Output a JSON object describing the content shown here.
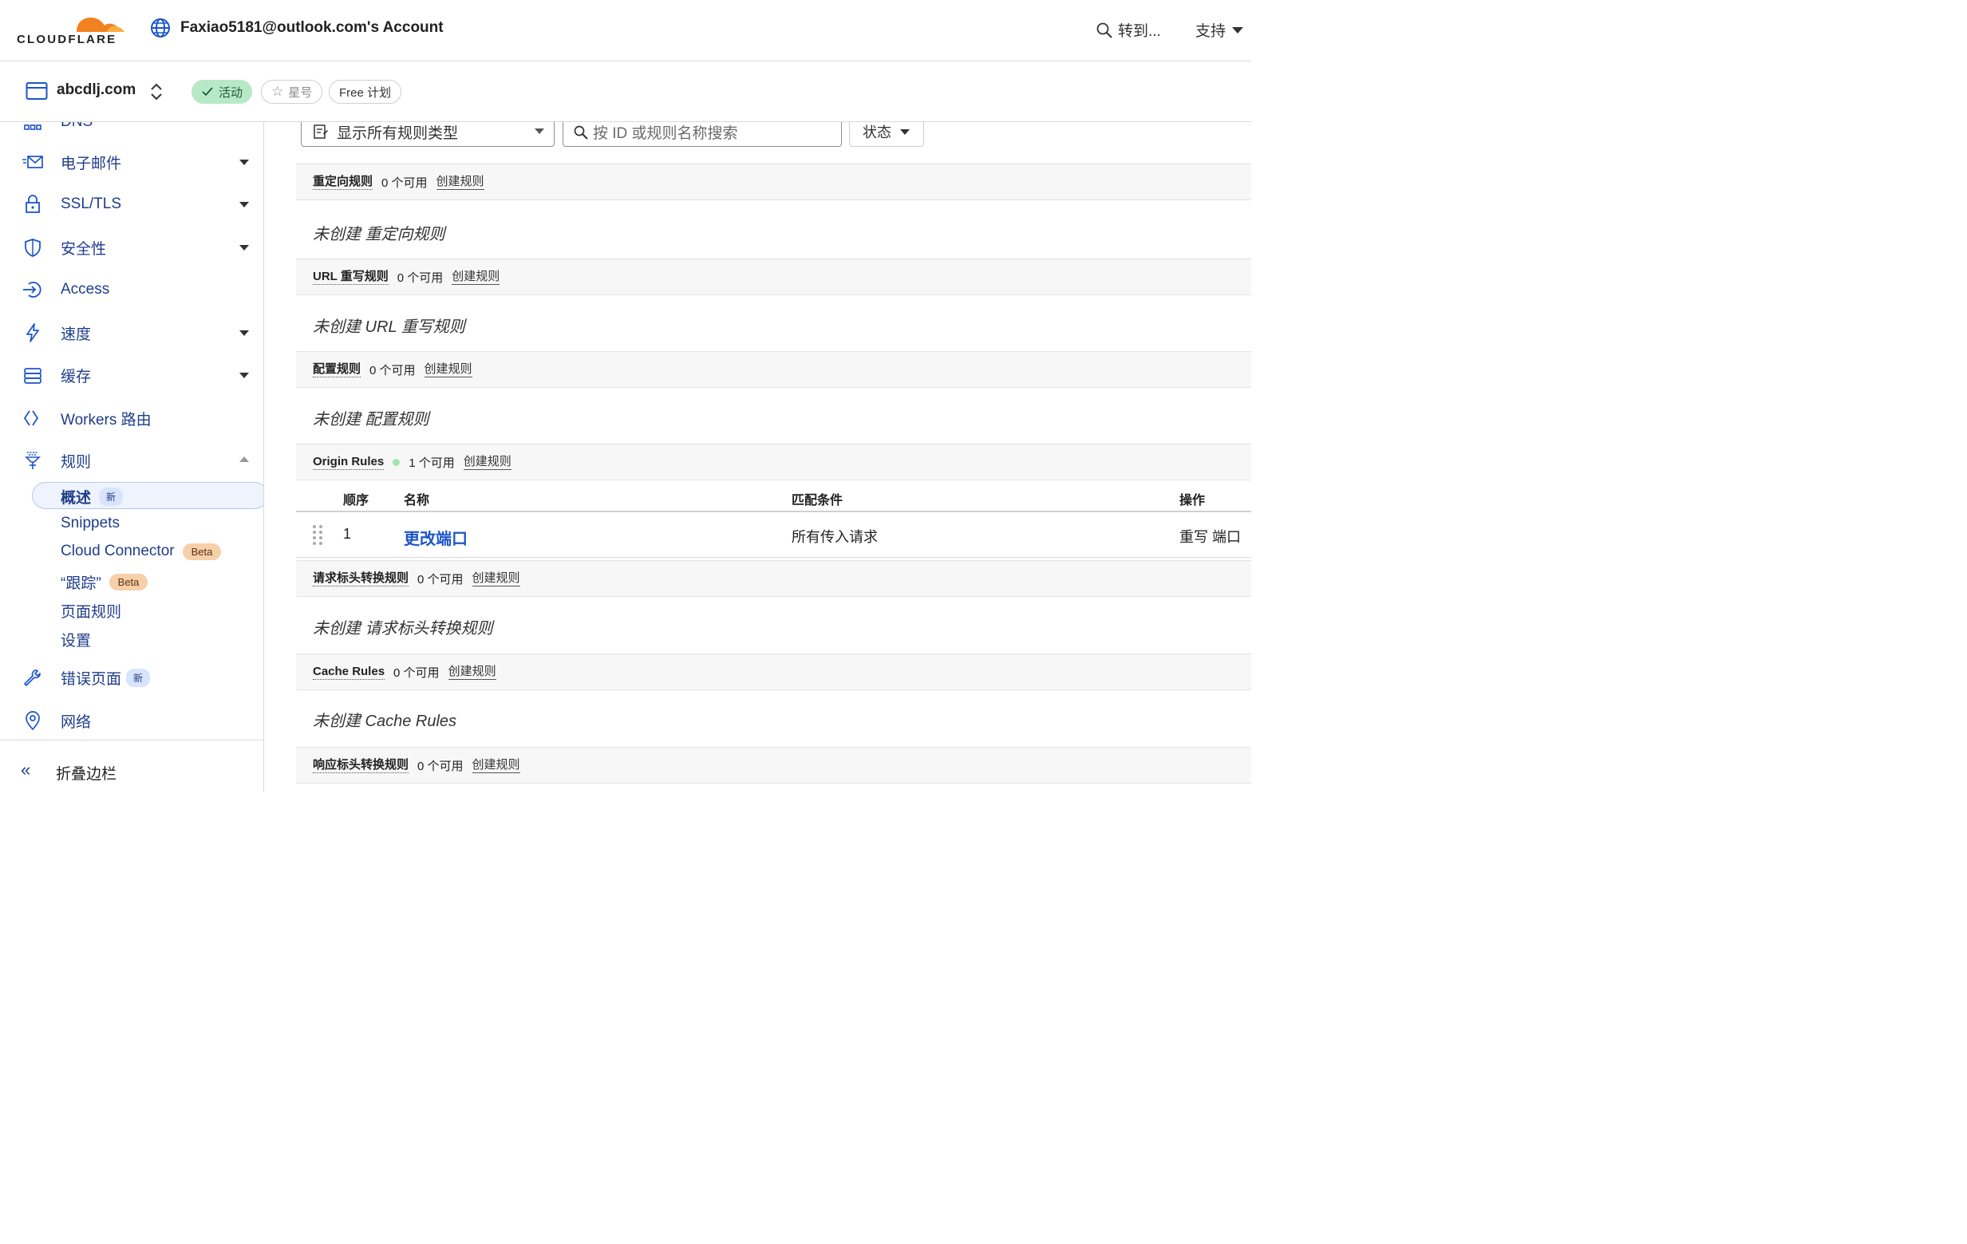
{
  "topbar": {
    "brand": "CLOUDFLARE",
    "account_title": "Faxiao5181@outlook.com's Account",
    "goto_label": "转到...",
    "support_label": "支持"
  },
  "zone": {
    "domain": "abcdlj.com",
    "status": "活动",
    "star_label": "星号",
    "plan": "Free 计划"
  },
  "sidebar": {
    "dns_partial": "DNS",
    "items": [
      {
        "label": "电子邮件",
        "icon": "email-icon"
      },
      {
        "label": "SSL/TLS",
        "icon": "lock-icon"
      },
      {
        "label": "安全性",
        "icon": "shield-icon"
      },
      {
        "label": "Access",
        "icon": "access-icon"
      },
      {
        "label": "速度",
        "icon": "bolt-icon"
      },
      {
        "label": "缓存",
        "icon": "cache-icon"
      },
      {
        "label": "Workers 路由",
        "icon": "workers-icon"
      },
      {
        "label": "规则",
        "icon": "rules-icon"
      }
    ],
    "rules_sub": {
      "overview": "概述",
      "overview_badge": "新",
      "snippets": "Snippets",
      "cloud_connector": "Cloud Connector",
      "cloud_connector_badge": "Beta",
      "trace": "“跟踪”",
      "trace_badge": "Beta",
      "page_rules": "页面规则",
      "settings": "设置"
    },
    "error_pages": "错误页面",
    "error_pages_badge": "新",
    "network": "网络",
    "collapse_label": "折叠边栏"
  },
  "filters": {
    "rule_type": "显示所有规则类型",
    "search_placeholder": "按 ID 或规则名称搜索",
    "status": "状态"
  },
  "sections": {
    "redirect": {
      "title": "重定向规则",
      "count": "0 个可用",
      "create": "创建规则",
      "empty": "未创建 重定向规则"
    },
    "url_rewrite": {
      "title": "URL 重写规则",
      "count": "0 个可用",
      "create": "创建规则",
      "empty": "未创建 URL 重写规则"
    },
    "config": {
      "title": "配置规则",
      "count": "0 个可用",
      "create": "创建规则",
      "empty": "未创建 配置规则"
    },
    "origin": {
      "title": "Origin Rules",
      "count": "1 个可用",
      "create": "创建规则"
    },
    "request_header": {
      "title": "请求标头转换规则",
      "count": "0 个可用",
      "create": "创建规则",
      "empty": "未创建 请求标头转换规则"
    },
    "cache": {
      "title": "Cache Rules",
      "count": "0 个可用",
      "create": "创建规则",
      "empty": "未创建 Cache Rules"
    },
    "response_header": {
      "title": "响应标头转换规则",
      "count": "0 个可用",
      "create": "创建规则"
    }
  },
  "origin_table": {
    "headers": {
      "order": "顺序",
      "name": "名称",
      "match": "匹配条件",
      "action": "操作"
    },
    "rows": [
      {
        "order": "1",
        "name": "更改端口",
        "match": "所有传入请求",
        "action": "重写 端口 "
      }
    ]
  },
  "colors": {
    "brand_orange": "#f48120",
    "link_blue": "#1c55c8",
    "active_green": "#b8e9c6",
    "nav_blue": "#1f3d8a"
  }
}
